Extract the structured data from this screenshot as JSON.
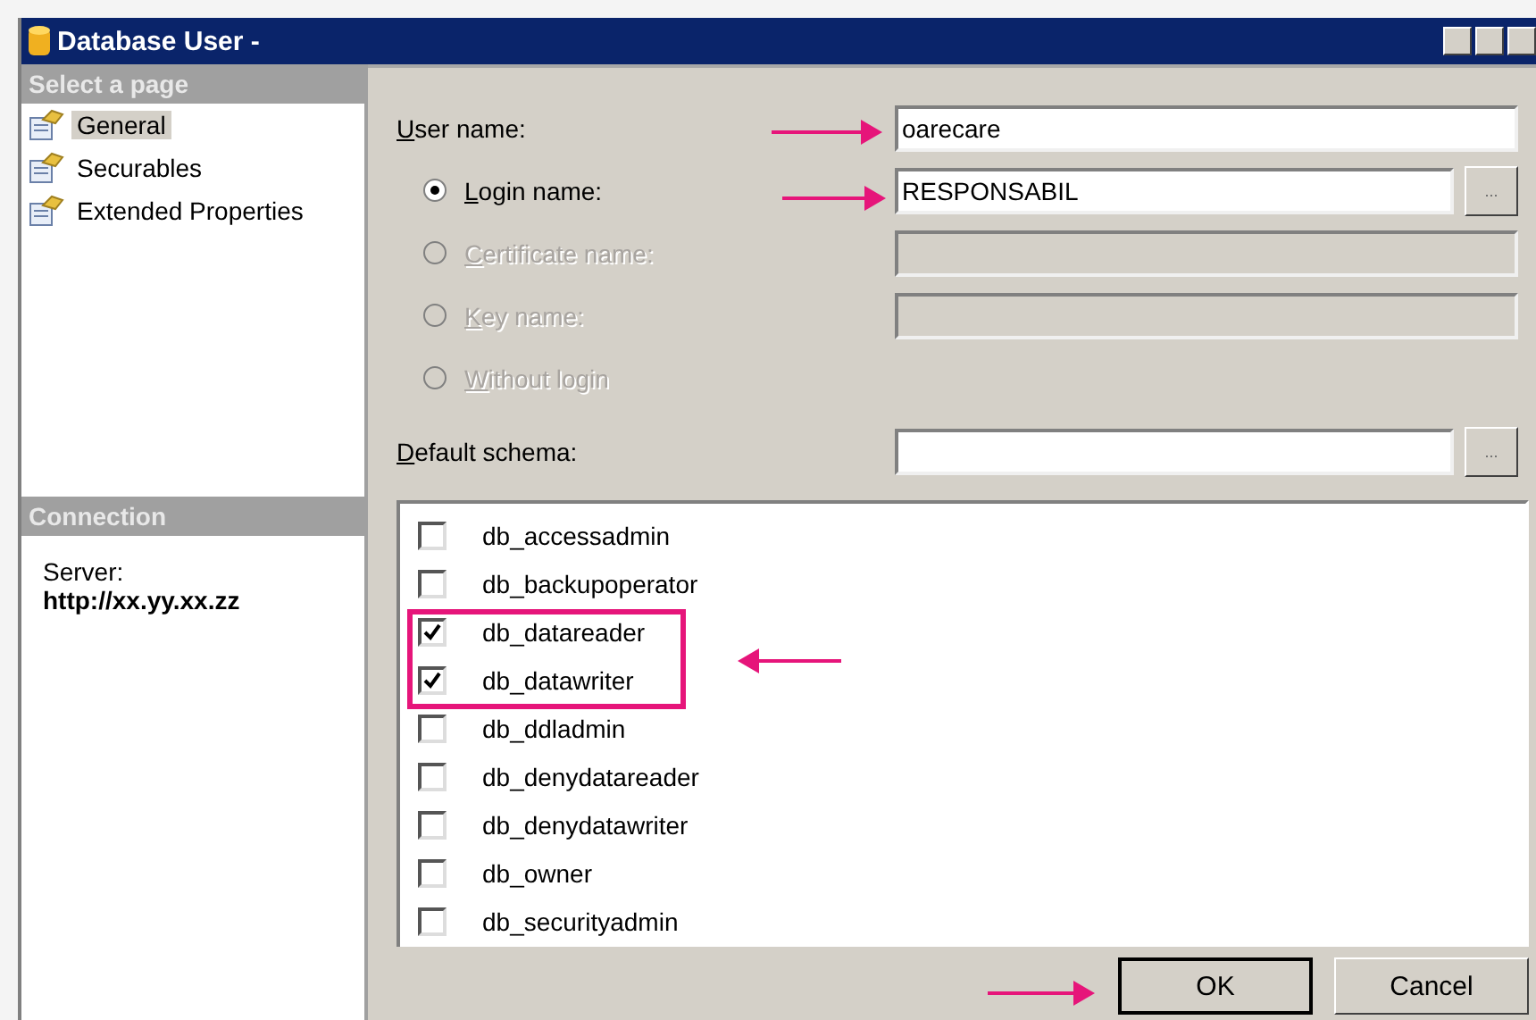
{
  "window": {
    "title": "Database User -"
  },
  "sidebar": {
    "header": "Select a page",
    "items": [
      {
        "label": "General",
        "selected": true
      },
      {
        "label": "Securables",
        "selected": false
      },
      {
        "label": "Extended Properties",
        "selected": false
      }
    ]
  },
  "connection": {
    "header": "Connection",
    "server_label": "Server:",
    "server": "http://xx.yy.xx.zz"
  },
  "form": {
    "user_name": {
      "label": "User name:",
      "value": "oarecare"
    },
    "login_options": [
      {
        "label": "Login name:",
        "selected": true,
        "disabled": false,
        "value": "RESPONSABIL",
        "has_browse": true,
        "browse_label": "..."
      },
      {
        "label": "Certificate name:",
        "selected": false,
        "disabled": true
      },
      {
        "label": "Key name:",
        "selected": false,
        "disabled": true
      },
      {
        "label": "Without login",
        "selected": false,
        "disabled": true
      }
    ],
    "default_schema": {
      "label": "Default schema:",
      "browse_label": "..."
    }
  },
  "roles": [
    {
      "label": "db_accessadmin",
      "checked": false
    },
    {
      "label": "db_backupoperator",
      "checked": false
    },
    {
      "label": "db_datareader",
      "checked": true
    },
    {
      "label": "db_datawriter",
      "checked": true
    },
    {
      "label": "db_ddladmin",
      "checked": false
    },
    {
      "label": "db_denydatareader",
      "checked": false
    },
    {
      "label": "db_denydatawriter",
      "checked": false
    },
    {
      "label": "db_owner",
      "checked": false
    },
    {
      "label": "db_securityadmin",
      "checked": false
    }
  ],
  "buttons": [
    {
      "label": "OK",
      "default": true
    },
    {
      "label": "Cancel",
      "default": false
    }
  ]
}
